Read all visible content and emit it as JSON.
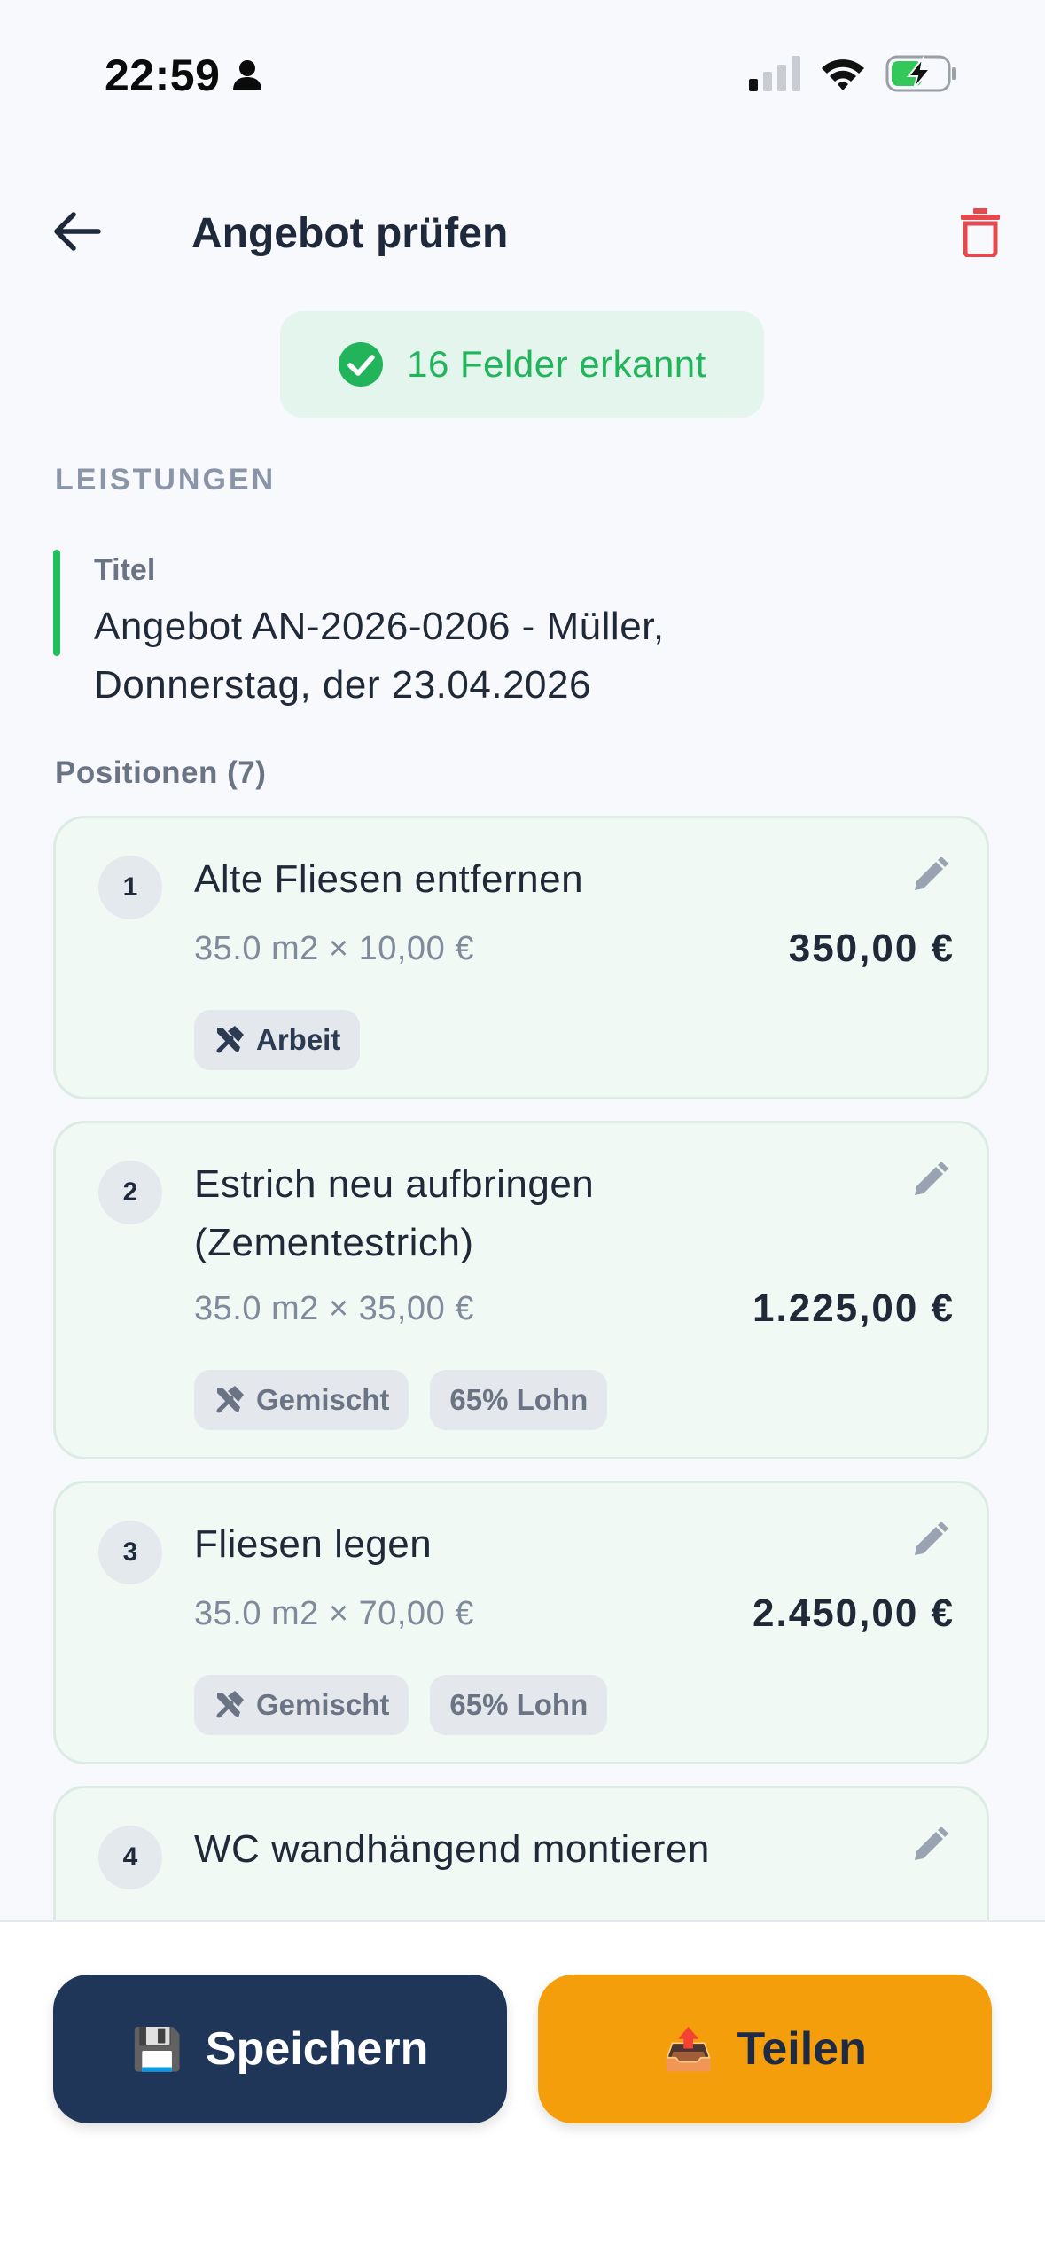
{
  "status_bar": {
    "time": "22:59"
  },
  "header": {
    "title": "Angebot prüfen"
  },
  "detected": {
    "text": "16 Felder erkannt"
  },
  "section": {
    "label": "LEISTUNGEN"
  },
  "title_field": {
    "label": "Titel",
    "value_line1": "Angebot AN-2026-0206 - Müller,",
    "value_line2": "Donnerstag, der 23.04.2026"
  },
  "positions": {
    "label": "Positionen (7)",
    "items": [
      {
        "num": "1",
        "name": "Alte Fliesen entfernen",
        "qty": "35.0 m2 × 10,00 €",
        "price": "350,00 €",
        "type": "Arbeit",
        "share": ""
      },
      {
        "num": "2",
        "name": "Estrich neu aufbringen (Zementestrich)",
        "qty": "35.0 m2 × 35,00 €",
        "price": "1.225,00 €",
        "type": "Gemischt",
        "share": "65% Lohn"
      },
      {
        "num": "3",
        "name": "Fliesen legen",
        "qty": "35.0 m2 × 70,00 €",
        "price": "2.450,00 €",
        "type": "Gemischt",
        "share": "65% Lohn"
      },
      {
        "num": "4",
        "name": "WC wandhängend montieren"
      }
    ]
  },
  "actions": {
    "save_icon": "💾",
    "save_label": "Speichern",
    "share_icon": "📤",
    "share_label": "Teilen"
  },
  "colors": {
    "primary": "#1f3658",
    "accent": "#f59e0b",
    "success": "#22c05a",
    "danger": "#e5484d"
  }
}
